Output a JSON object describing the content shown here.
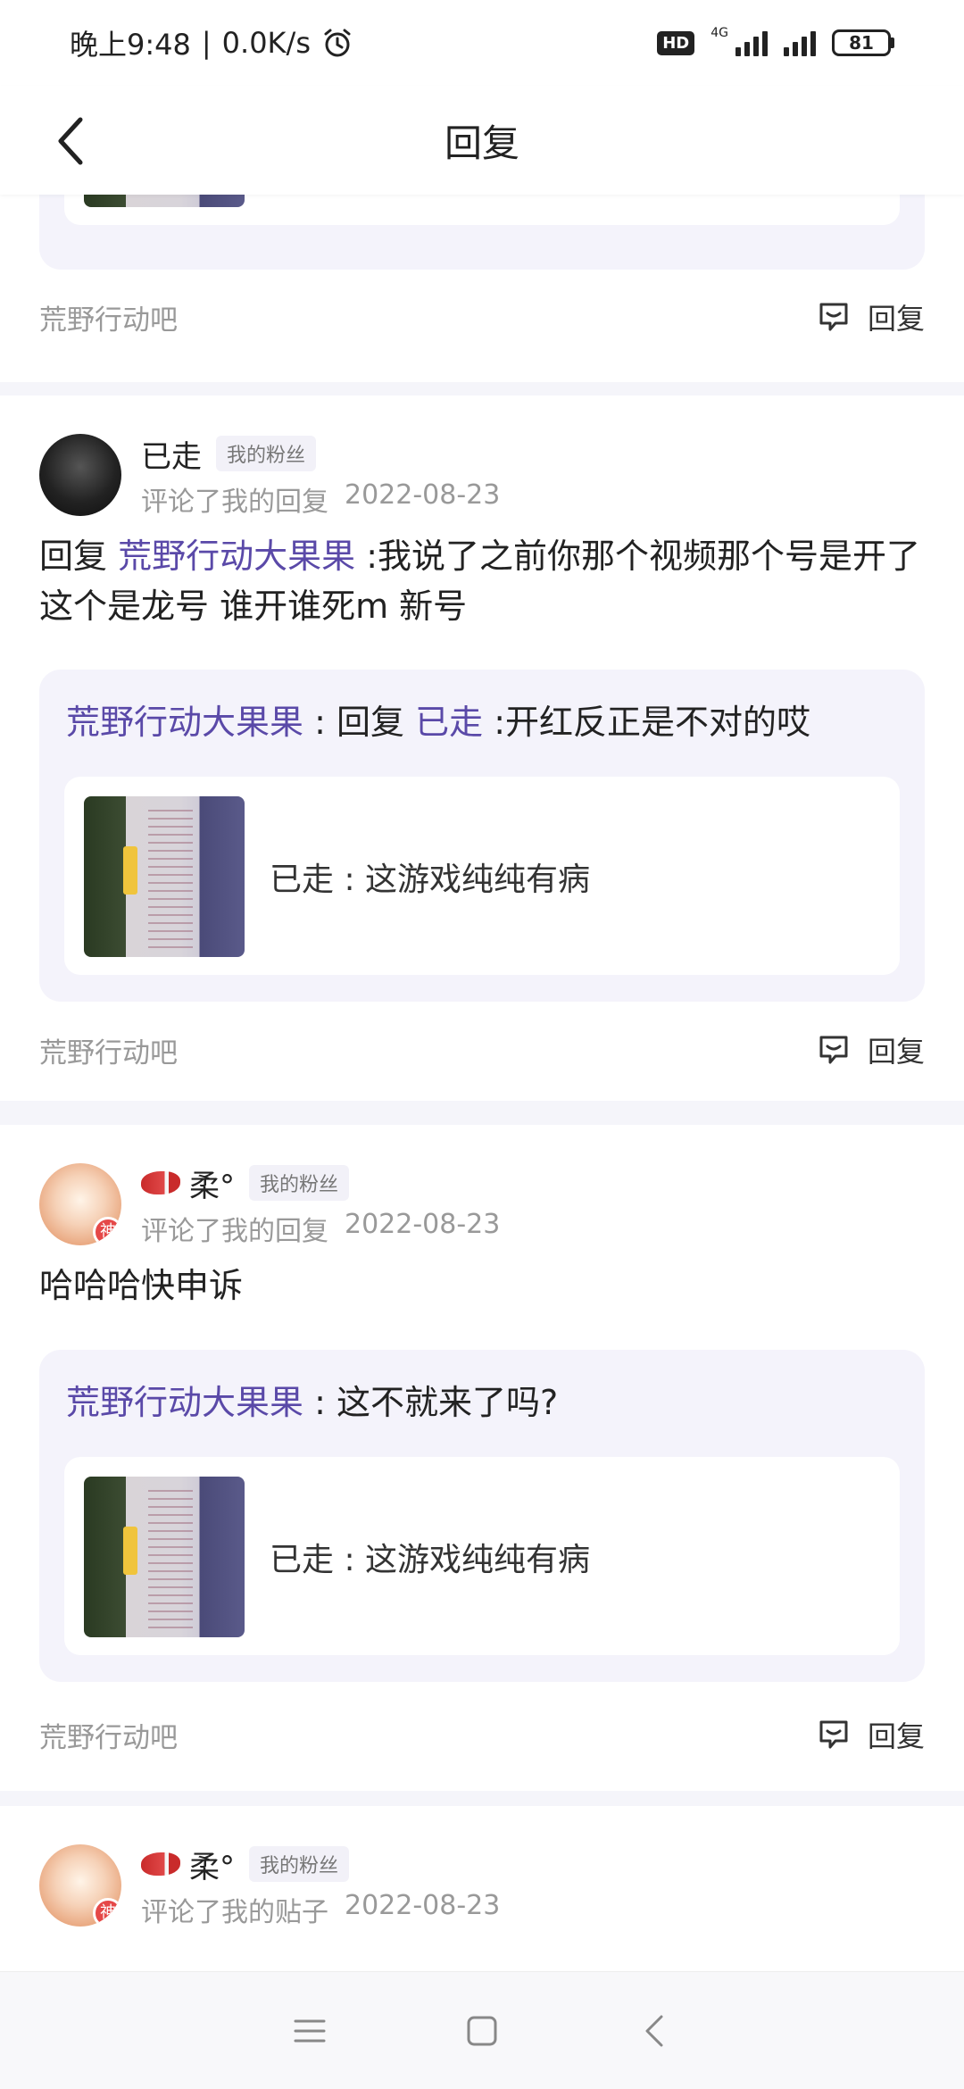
{
  "status_bar": {
    "time": "晚上9:48",
    "speed": "0.0K/s",
    "hd": "HD",
    "network": "4G",
    "battery": "81"
  },
  "header": {
    "title": "回复"
  },
  "top_card": {
    "forum": "荒野行动吧",
    "reply_label": "回复"
  },
  "notifications": [
    {
      "user_name": "已走",
      "fan_tag": "我的粉丝",
      "action": "评论了我的回复",
      "date": "2022-08-23",
      "text_prefix": "回复",
      "mention": "荒野行动大果果",
      "text_body": ":我说了之前你那个视频那个号是开了 这个是龙号 谁开谁死m 新号",
      "quote_author": "荒野行动大果果",
      "quote_sep": ":",
      "quote_reply_word": "回复",
      "quote_mention": "已走",
      "quote_text": ":开红反正是不对的哎",
      "inner_text": "已走 : 这游戏纯纯有病",
      "forum": "荒野行动吧",
      "reply_label": "回复"
    },
    {
      "user_name": "柔°",
      "fan_tag": "我的粉丝",
      "action": "评论了我的回复",
      "date": "2022-08-23",
      "text": "哈哈哈快申诉",
      "quote_author": "荒野行动大果果",
      "quote_sep": ":",
      "quote_text": "这不就来了吗?",
      "inner_text": "已走 : 这游戏纯纯有病",
      "forum": "荒野行动吧",
      "reply_label": "回复",
      "badge": "神"
    },
    {
      "user_name": "柔°",
      "fan_tag": "我的粉丝",
      "action": "评论了我的贴子",
      "date": "2022-08-23",
      "badge": "神"
    }
  ],
  "icons": {
    "back": "chevron-left-icon",
    "reply": "comment-bubble-icon",
    "alarm": "alarm-clock-icon",
    "nav_menu": "menu-icon",
    "nav_home": "square-home-icon",
    "nav_back": "triangle-back-icon"
  }
}
